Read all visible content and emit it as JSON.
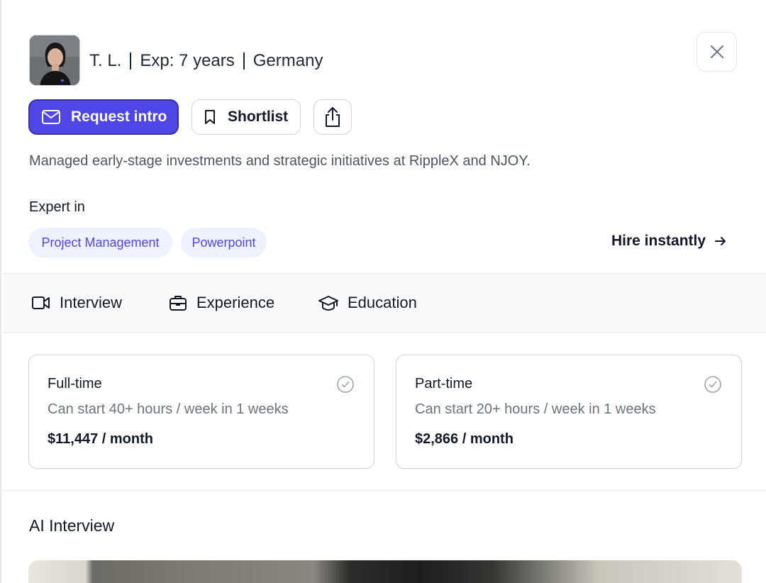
{
  "profile": {
    "name": "T. L.",
    "experience": "Exp: 7 years",
    "location": "Germany",
    "summary": "Managed early-stage investments and strategic initiatives at RippleX and NJOY."
  },
  "actions": {
    "request_intro_label": "Request intro",
    "shortlist_label": "Shortlist"
  },
  "expertise": {
    "label": "Expert in",
    "skills": [
      "Project Management",
      "Powerpoint"
    ],
    "hire_label": "Hire instantly"
  },
  "tabs": [
    {
      "label": "Interview",
      "icon": "video-camera-icon"
    },
    {
      "label": "Experience",
      "icon": "briefcase-icon"
    },
    {
      "label": "Education",
      "icon": "graduation-cap-icon"
    }
  ],
  "plans": [
    {
      "title": "Full-time",
      "description": "Can start 40+ hours / week in 1 weeks",
      "price": "$11,447 / month"
    },
    {
      "title": "Part-time",
      "description": "Can start 20+ hours / week in 1 weeks",
      "price": "$2,866 / month"
    }
  ],
  "ai_interview": {
    "heading": "AI Interview"
  },
  "colors": {
    "accent": "#4f46e5",
    "chip_bg": "#eef2ff",
    "tabs_bg": "#f8fafc"
  }
}
